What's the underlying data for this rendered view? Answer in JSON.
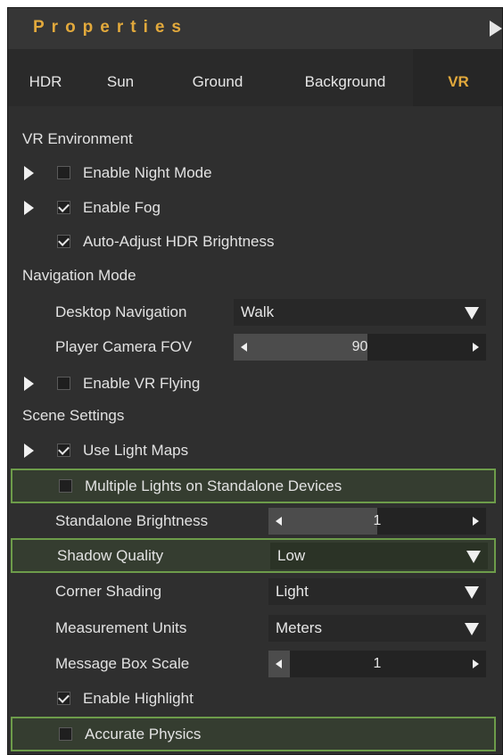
{
  "panel": {
    "title": "Properties"
  },
  "tabs": [
    {
      "label": "HDR"
    },
    {
      "label": "Sun"
    },
    {
      "label": "Ground"
    },
    {
      "label": "Background"
    },
    {
      "label": "VR",
      "active": true
    }
  ],
  "sections": {
    "vr_environment": "VR Environment",
    "navigation_mode": "Navigation Mode",
    "scene_settings": "Scene Settings"
  },
  "options": {
    "enable_night_mode": {
      "label": "Enable Night Mode",
      "checked": false
    },
    "enable_fog": {
      "label": "Enable Fog",
      "checked": true
    },
    "auto_adjust_hdr": {
      "label": "Auto-Adjust HDR Brightness",
      "checked": true
    },
    "desktop_navigation": {
      "label": "Desktop Navigation",
      "value": "Walk"
    },
    "player_camera_fov": {
      "label": "Player Camera FOV",
      "value": "90",
      "fill_fraction": 0.53
    },
    "enable_vr_flying": {
      "label": "Enable VR Flying",
      "checked": false
    },
    "use_light_maps": {
      "label": "Use Light Maps",
      "checked": true
    },
    "multiple_lights": {
      "label": "Multiple Lights on Standalone Devices",
      "checked": false
    },
    "standalone_brightness": {
      "label": "Standalone Brightness",
      "value": "1",
      "fill_fraction": 0.5
    },
    "shadow_quality": {
      "label": "Shadow Quality",
      "value": "Low"
    },
    "corner_shading": {
      "label": "Corner Shading",
      "value": "Light"
    },
    "measurement_units": {
      "label": "Measurement Units",
      "value": "Meters"
    },
    "message_box_scale": {
      "label": "Message Box Scale",
      "value": "1",
      "fill_fraction": 0.1
    },
    "enable_highlight": {
      "label": "Enable Highlight",
      "checked": true
    },
    "accurate_physics": {
      "label": "Accurate Physics",
      "checked": false
    }
  },
  "colors": {
    "accent": "#e2a93c",
    "highlight_border": "#6d9c4a",
    "panel_bg": "#2f2f2f"
  },
  "icons": {
    "expand": "triangle-right-icon",
    "dropdown": "triangle-down-icon",
    "collapse": "triangle-right-icon"
  }
}
